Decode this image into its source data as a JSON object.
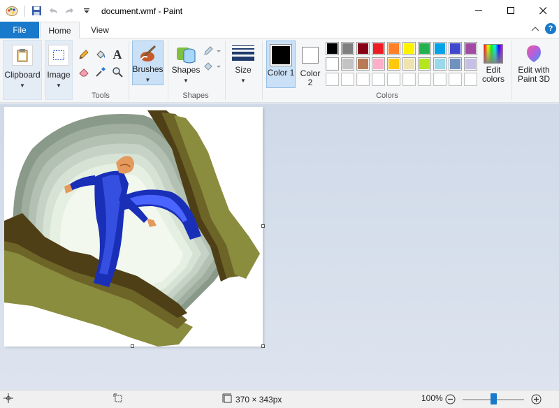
{
  "window": {
    "title": "document.wmf - Paint"
  },
  "tabs": {
    "file": "File",
    "home": "Home",
    "view": "View"
  },
  "ribbon": {
    "clipboard_label": "Clipboard",
    "image_label": "Image",
    "tools_label": "Tools",
    "brushes_label": "Brushes",
    "shapes_label": "Shapes",
    "shapes_group_label": "Shapes",
    "size_label": "Size",
    "color1_label": "Color 1",
    "color2_label": "Color 2",
    "edit_colors_label": "Edit colors",
    "colors_group_label": "Colors",
    "edit_paint3d_label": "Edit with Paint 3D"
  },
  "colors": {
    "color1": "#000000",
    "color2": "#ffffff",
    "palette_row1": [
      "#000000",
      "#7f7f7f",
      "#880015",
      "#ed1c24",
      "#ff7f27",
      "#fff200",
      "#22b14c",
      "#00a2e8",
      "#3f48cc",
      "#a349a4"
    ],
    "palette_row2": [
      "#ffffff",
      "#c3c3c3",
      "#b97a57",
      "#ffaec9",
      "#ffc90e",
      "#efe4b0",
      "#b5e61d",
      "#99d9ea",
      "#7092be",
      "#c8bfe7"
    ],
    "palette_row3": [
      "#ffffff",
      "#ffffff",
      "#ffffff",
      "#ffffff",
      "#ffffff",
      "#ffffff",
      "#ffffff",
      "#ffffff",
      "#ffffff",
      "#ffffff"
    ],
    "accent": "#1979ca"
  },
  "statusbar": {
    "image_size": "370 × 343px",
    "zoom": "100%",
    "zoom_fraction": 0.5
  }
}
